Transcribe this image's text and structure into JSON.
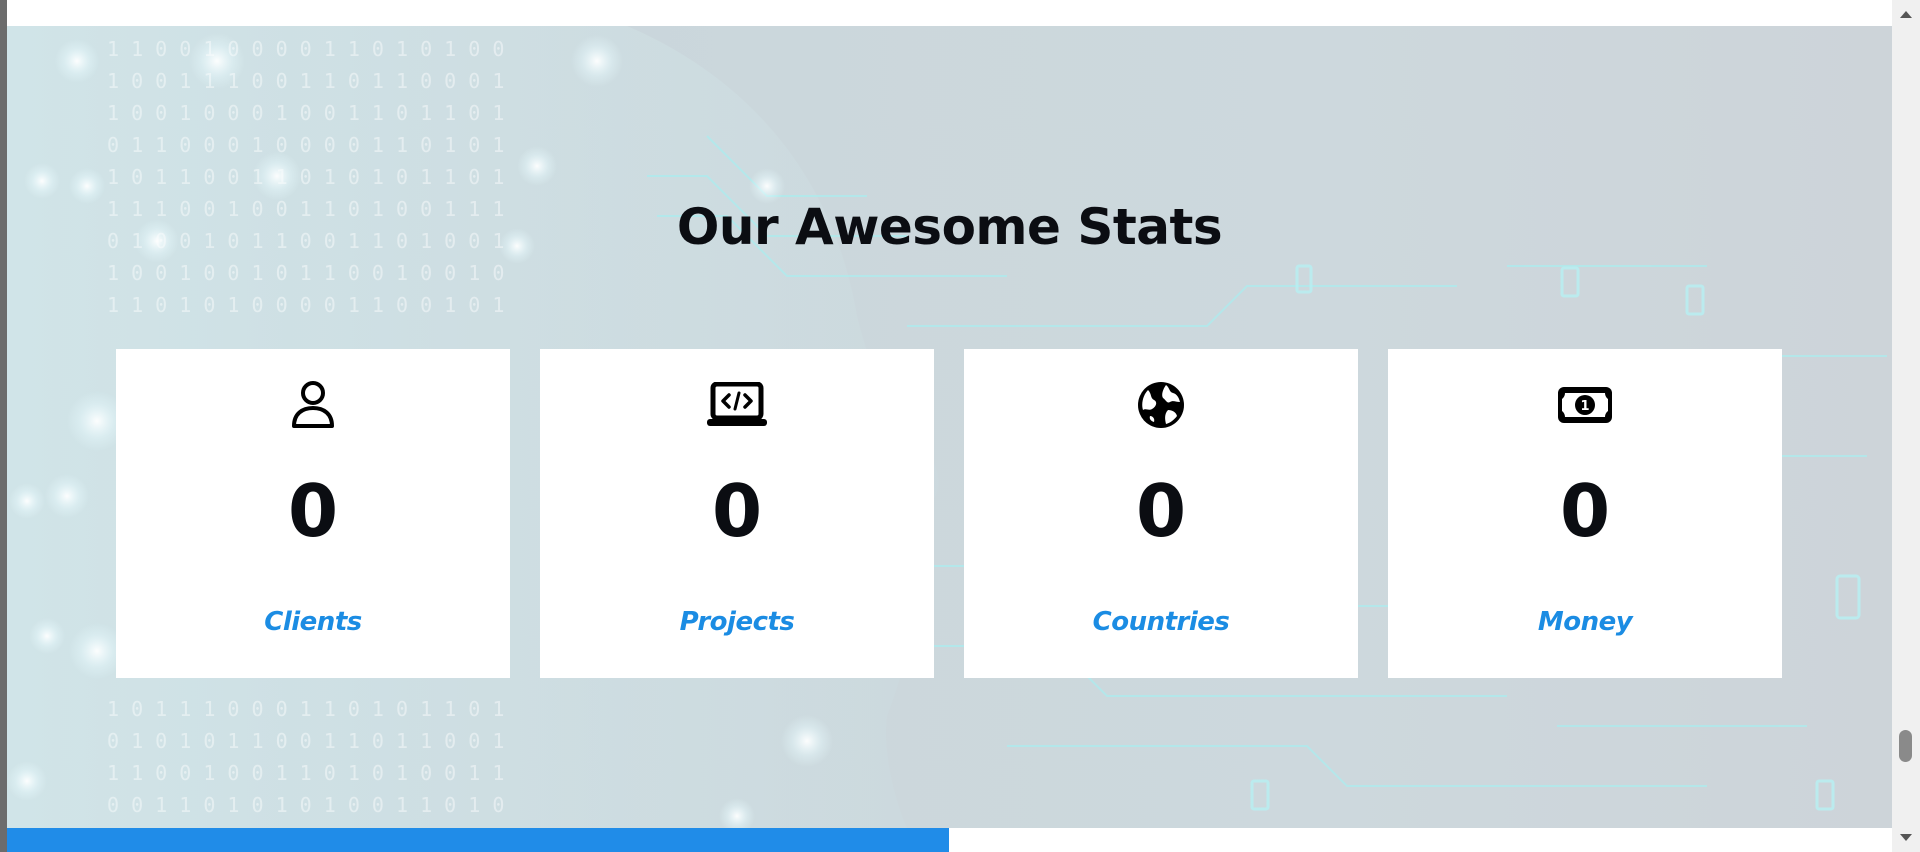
{
  "section": {
    "title": "Our Awesome Stats"
  },
  "stats": [
    {
      "icon": "user-icon",
      "value": "0",
      "label": "Clients"
    },
    {
      "icon": "laptop-code-icon",
      "value": "0",
      "label": "Projects"
    },
    {
      "icon": "globe-icon",
      "value": "0",
      "label": "Countries"
    },
    {
      "icon": "money-bill-icon",
      "value": "0",
      "label": "Money"
    }
  ],
  "colors": {
    "label_accent": "#1b8ce3",
    "bottom_bar": "#208ce8",
    "title_text": "#0b0d12",
    "section_bg": "#cbd7dc"
  }
}
